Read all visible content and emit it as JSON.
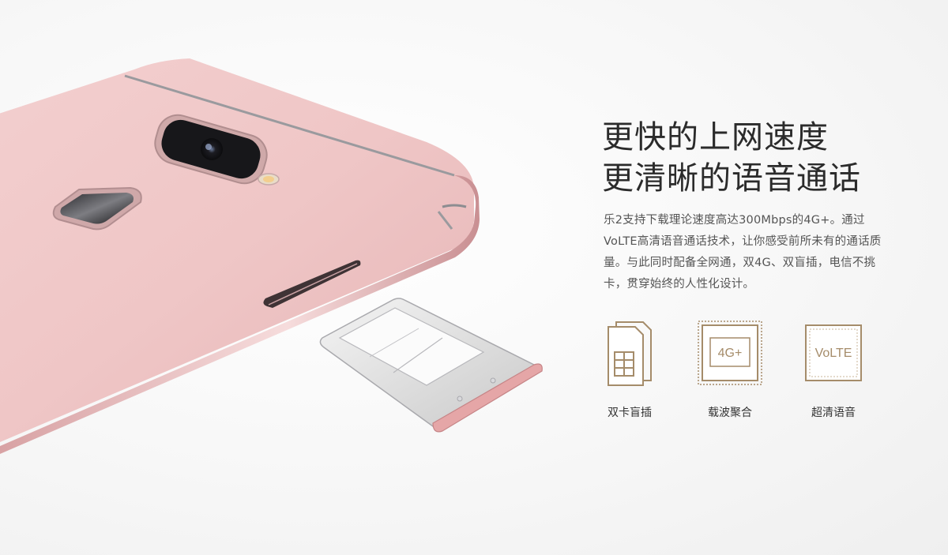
{
  "heading": {
    "line1": "更快的上网速度",
    "line2": "更清晰的语音通话"
  },
  "description": "乐2支持下载理论速度高达300Mbps的4G+。通过VoLTE高清语音通话技术，让你感受前所未有的通话质量。与此同时配备全网通，双4G、双盲插，电信不挑卡，贯穿始终的人性化设计。",
  "features": [
    {
      "label": "双卡盲插",
      "icon": "dual-sim-icon"
    },
    {
      "label": "载波聚合",
      "icon": "carrier-aggregation-4g-icon",
      "icon_text": "4G+"
    },
    {
      "label": "超清语音",
      "icon": "volte-icon",
      "icon_text": "VoLTE"
    }
  ],
  "colors": {
    "phone_body": "#f0c4c4",
    "icon_gold": "#a58c6a",
    "heading_text": "#2b2b2b",
    "body_text": "#555555"
  }
}
